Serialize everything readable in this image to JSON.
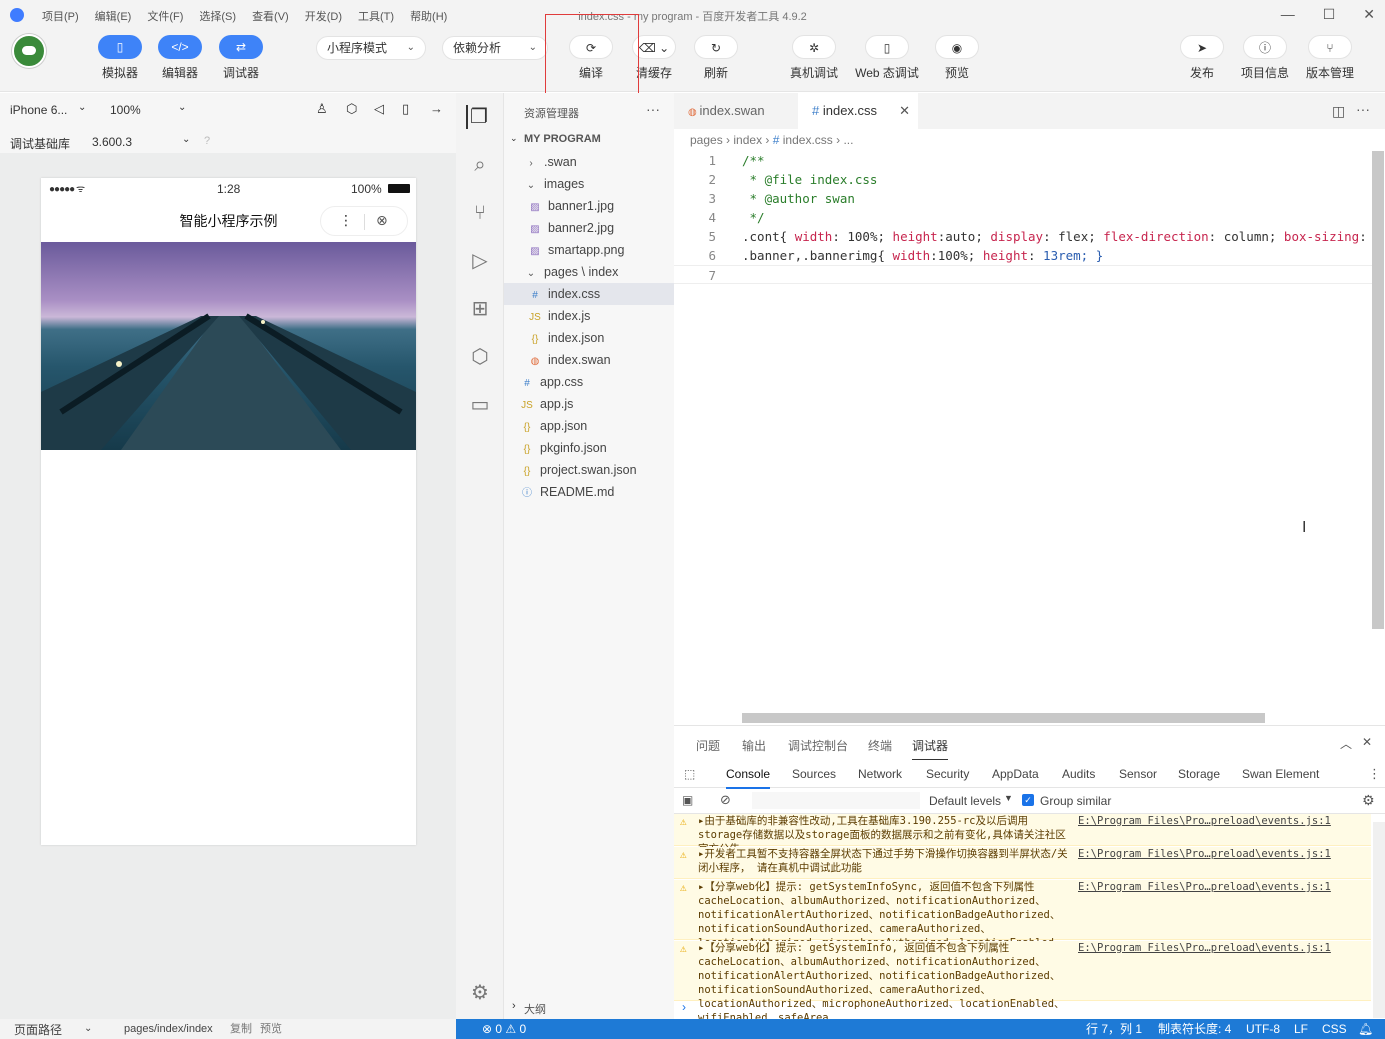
{
  "window": {
    "title": "index.css - my program - 百度开发者工具 4.9.2",
    "menu": [
      "项目(P)",
      "编辑(E)",
      "文件(F)",
      "选择(S)",
      "查看(V)",
      "开发(D)",
      "工具(T)",
      "帮助(H)"
    ]
  },
  "toolbar": {
    "simulator": "模拟器",
    "editor": "编辑器",
    "debugger": "调试器",
    "mode": "小程序模式",
    "deps": "依赖分析",
    "compile": "编译",
    "clear_cache": "清缓存",
    "refresh": "刷新",
    "real_debug": "真机调试",
    "web_debug": "Web 态调试",
    "preview": "预览",
    "publish": "发布",
    "project_info": "项目信息",
    "version": "版本管理"
  },
  "sim": {
    "device": "iPhone 6...",
    "zoom": "100%",
    "base_lib_label": "调试基础库",
    "base_lib": "3.600.3",
    "status_time": "1:28",
    "status_battery": "100%",
    "nav_title": "智能小程序示例",
    "path_label": "页面路径",
    "path": "pages/index/index",
    "copy": "复制",
    "preview": "预览"
  },
  "explorer": {
    "title": "资源管理器",
    "root": "MY PROGRAM",
    "outline": "大纲",
    "items": [
      {
        "label": ".swan",
        "icon": "chevron-right-icon"
      },
      {
        "label": "images",
        "icon": "chevron-down-icon"
      },
      {
        "label": "banner1.jpg",
        "icon": "image-icon"
      },
      {
        "label": "banner2.jpg",
        "icon": "image-icon"
      },
      {
        "label": "smartapp.png",
        "icon": "image-icon"
      },
      {
        "label": "pages \\ index",
        "icon": "chevron-down-icon"
      },
      {
        "label": "index.css",
        "icon": "css-icon"
      },
      {
        "label": "index.js",
        "icon": "js-icon"
      },
      {
        "label": "index.json",
        "icon": "json-icon"
      },
      {
        "label": "index.swan",
        "icon": "swan-icon"
      },
      {
        "label": "app.css",
        "icon": "css-icon"
      },
      {
        "label": "app.js",
        "icon": "js-icon"
      },
      {
        "label": "app.json",
        "icon": "json-icon"
      },
      {
        "label": "pkginfo.json",
        "icon": "json-icon"
      },
      {
        "label": "project.swan.json",
        "icon": "json-icon"
      },
      {
        "label": "README.md",
        "icon": "info-icon"
      }
    ]
  },
  "editor": {
    "tabs": [
      {
        "label": "index.swan",
        "icon": "swan-icon"
      },
      {
        "label": "index.css",
        "icon": "css-icon"
      }
    ],
    "breadcrumb": [
      "pages",
      "index",
      "#",
      "index.css",
      "..."
    ],
    "lines": [
      {
        "n": "1",
        "t": "/**"
      },
      {
        "n": "2",
        "t": " * @file index.css"
      },
      {
        "n": "3",
        "t": " * @author swan"
      },
      {
        "n": "4",
        "t": " */"
      },
      {
        "n": "5",
        "t": ".cont{ width: 100%; height:auto; display: flex; flex-direction: column; box-sizing:"
      },
      {
        "n": "6",
        "t": ".banner,.bannerimg{ width:100%; height: 13rem; }"
      },
      {
        "n": "7",
        "t": ""
      }
    ]
  },
  "panel": {
    "tabs": [
      "问题",
      "输出",
      "调试控制台",
      "终端",
      "调试器"
    ],
    "devtabs": [
      "Console",
      "Sources",
      "Network",
      "Security",
      "AppData",
      "Audits",
      "Sensor",
      "Storage",
      "Swan Element"
    ],
    "levels": "Default levels",
    "group": "Group similar",
    "messages": [
      {
        "text": "▸由于基础库的非兼容性改动,工具在基础库3.190.255-rc及以后调用storage存储数据以及storage面板的数据展示和之前有变化,具体请关注社区官方公告",
        "link": "E:\\Program Files\\Pro…preload\\events.js:1"
      },
      {
        "text": "▸开发者工具暂不支持容器全屏状态下通过手势下滑操作切换容器到半屏状态/关闭小程序， 请在真机中调试此功能",
        "link": "E:\\Program Files\\Pro…preload\\events.js:1"
      },
      {
        "text": "▸【分享web化】提示: getSystemInfoSync, 返回值不包含下列属性 cacheLocation、albumAuthorized、notificationAuthorized、notificationAlertAuthorized、notificationBadgeAuthorized、notificationSoundAuthorized、cameraAuthorized、locationAuthorized、microphoneAuthorized、locationEnabled、wifiEnabled、safeArea",
        "link": "E:\\Program Files\\Pro…preload\\events.js:1"
      },
      {
        "text": "▸【分享web化】提示: getSystemInfo, 返回值不包含下列属性 cacheLocation、albumAuthorized、notificationAuthorized、notificationAlertAuthorized、notificationBadgeAuthorized、notificationSoundAuthorized、cameraAuthorized、locationAuthorized、microphoneAuthorized、locationEnabled、wifiEnabled、safeArea",
        "link": "E:\\Program Files\\Pro…preload\\events.js:1"
      }
    ]
  },
  "status": {
    "errors": "0",
    "warnings": "0",
    "pos": "行 7，列 1",
    "tab": "制表符长度: 4",
    "enc": "UTF-8",
    "eol": "LF",
    "lang": "CSS"
  }
}
